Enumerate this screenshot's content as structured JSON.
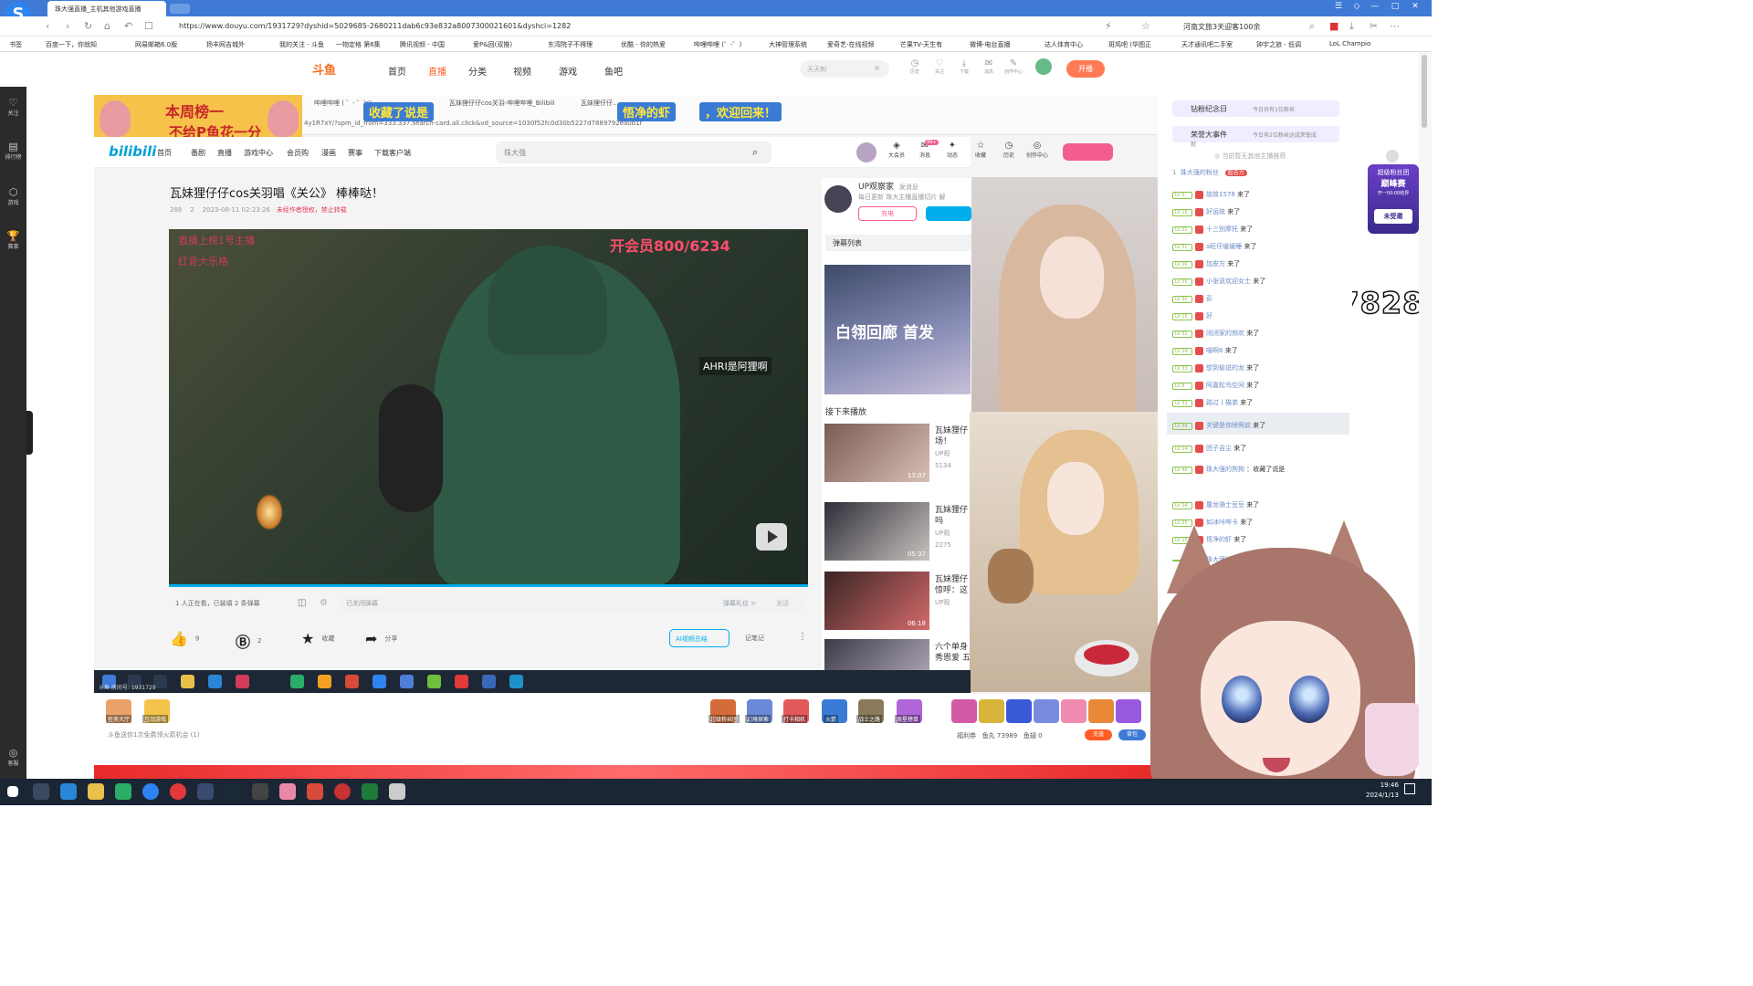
{
  "browser": {
    "tab_title": "珠大强直播_主机其他游戏直播",
    "url": "https://www.douyu.com/1931729?dyshid=5029685-2680211dab6c93e832a8007300021601&dyshci=1282",
    "right_text": "河南文旅3天迎客100余",
    "logo_letter": "S",
    "bookmarks": [
      "书签",
      "百度一下，你就知",
      "网易邮箱6.0版",
      "扬丰网吉城外",
      "我的关注 - 斗鱼",
      "一物定格 第6集",
      "腾讯视频 - 中国",
      "爱P&回(双推)",
      "东湾院子不得理",
      "优酷 - 你的热爱",
      "哔哩哔哩 (゜-゜)",
      "大神管理系统",
      "爱奇艺-在线视频",
      "芒果TV-天生有",
      "微博-电台直播",
      "达人体育中心",
      "斑鸠吧 (华图正",
      "天才通讯吧二手室",
      "钟宇之旅 - 低调",
      "LoL Champio"
    ]
  },
  "douyu": {
    "logo": "斗鱼",
    "nav": [
      "首页",
      "直播",
      "分类",
      "视频",
      "游戏",
      "鱼吧"
    ],
    "search_placeholder": "天天刺",
    "header_icons": [
      "历史",
      "关注",
      "下载",
      "消息",
      "创作中心"
    ],
    "badge_msg": "1",
    "badge_user": "83",
    "kaibo": "开播",
    "left_sidebar": [
      {
        "icon": "♡",
        "label": "关注"
      },
      {
        "icon": "▤",
        "label": "排行榜"
      },
      {
        "icon": "⬡",
        "label": "游戏"
      },
      {
        "icon": "🏆",
        "label": "赛事"
      },
      {
        "icon": "◎",
        "label": "客服"
      }
    ]
  },
  "stream": {
    "banner_line1": "本周榜一",
    "banner_line2": "不给P鱼花一分",
    "banner_tags": [
      "收藏了说是",
      "悟净的虾",
      "，欢迎回来！"
    ],
    "inner_tabs": [
      "哔哩哔哩 ( ゜- ゜)つ",
      "瓦妹狸仔仔cos关羽-哔哩哔哩_Bilibili",
      "瓦妹狸仔仔..."
    ],
    "inner_url": "4y1R7xY/?spm_id_from=333.337.search-card.all.click&vd_source=1030f52fc0d30b5227d7889792ea0b1f",
    "bilibili": {
      "logo": "bilibili",
      "nav": [
        "首页",
        "番剧",
        "直播",
        "游戏中心",
        "会员购",
        "漫画",
        "赛事",
        "下载客户端"
      ],
      "search_placeholder": "珠大强",
      "icons": [
        "大会员",
        "消息",
        "动态",
        "收藏",
        "历史",
        "创作中心"
      ],
      "message_badge": "99+",
      "video_title": "瓦妹狸仔仔cos关羽唱《关公》 棒棒哒！",
      "meta_views": "288",
      "meta_danmu": "2",
      "meta_date": "2023-08-11 02:23:26",
      "meta_warning": "未经作者授权，禁止转载",
      "overlay_wm1": "直播上榜1号主播",
      "overlay_wm2": "红音大乐格",
      "overlay_counter": "开会员800/6234",
      "overlay_tag": "AHRI是阿狸啊",
      "watching": "1 人正在看，已装填 2 条弹幕",
      "danmu_placeholder": "已关闭弹幕",
      "danmu_gift": "弹幕礼仪 >",
      "send": "发送",
      "like_count": "9",
      "coin_count": "2",
      "collect": "收藏",
      "share": "分享",
      "ai_summary": "AI视频总结",
      "notes": "记笔记",
      "up_label": "UP观察家",
      "up_msg": "发消息",
      "up_sub": "每日更新 珠大主播直播切片 解",
      "charge": "充电",
      "danmu_list": "弹幕列表",
      "promo_text": "白翎回廊 首发",
      "next_play": "接下来播放",
      "recommend": [
        {
          "title": "瓦妹狸仔",
          "line2": "场！",
          "up": "UP观",
          "views": "5134",
          "duration": "13:07"
        },
        {
          "title": "瓦妹狸仔",
          "line2": "吗",
          "up": "UP观",
          "views": "2275",
          "duration": "05:37"
        },
        {
          "title": "瓦妹狸仔",
          "line2": "惊呼：这",
          "up": "UP观",
          "views": "",
          "duration": "06:18"
        },
        {
          "title": "六个单身",
          "line2": "秀恩爱 五",
          "up": "",
          "views": "",
          "duration": ""
        }
      ]
    },
    "qq_number": "485477828",
    "room_info": "斗鱼 房间号: 1931729",
    "msg_line": "斗鱼送你1次免费领火箭机会 (1)",
    "gifts": [
      "任务大厅",
      "互动游戏",
      "超级粉丝团",
      "幻境探索",
      "打卡相机",
      "火箭",
      "战士之路",
      "周星榜单"
    ],
    "fish_wan": "鱼丸 73989",
    "fish_chi": "鱼翅 0",
    "recharge": "充值",
    "backpack": "背包",
    "fans_count": "福利券"
  },
  "chat": {
    "top_items": [
      {
        "title": "钻粉纪念日",
        "sub": "今日共有1位粉丝"
      },
      {
        "title": "荣誉大事件",
        "sub": "今日有2位粉丝达成荣誉成就"
      }
    ],
    "notice": "◎ 当前暂无其他主播推荐",
    "rank_title": "珠大强的粉丝",
    "rank_badge": "超吉力",
    "messages": [
      {
        "lv": "LV 5",
        "name": "故故1578",
        "text": "来了"
      },
      {
        "lv": "LV 16",
        "name": "好运故",
        "text": "来了"
      },
      {
        "lv": "LV 21",
        "name": "十三别摩托",
        "text": "来了"
      },
      {
        "lv": "LV 31",
        "name": "a旺仔缓缓睡",
        "text": "来了"
      },
      {
        "lv": "LV 26",
        "name": "加皮方",
        "text": "来了"
      },
      {
        "lv": "LV 35",
        "name": "小张说欢迎女士",
        "text": "来了"
      },
      {
        "lv": "LV 30",
        "name": "彭",
        "text": ""
      },
      {
        "lv": "LV 15",
        "name": "好",
        "text": ""
      },
      {
        "lv": "LV 32",
        "name": "闭闭家的频欢",
        "text": "来了"
      },
      {
        "lv": "LV 24",
        "name": "喵啊6",
        "text": "来了"
      },
      {
        "lv": "LV 33",
        "name": "想到偷说的龙",
        "text": "来了"
      },
      {
        "lv": "LV 8",
        "name": "阿嘉松鸟空间",
        "text": "来了"
      },
      {
        "lv": "LV 33",
        "name": "路过丨猫弟",
        "text": "来了"
      },
      {
        "lv": "LV 44",
        "name": "关键是你除照前",
        "text": "来了"
      },
      {
        "lv": "LV 14",
        "name": "团子吉尘",
        "text": "来了"
      },
      {
        "lv": "LV 40",
        "name": "珠大强的狗狗",
        "text": "：收藏了说是"
      },
      {
        "lv": "LV 24",
        "name": "屠龙骑士豆豆",
        "text": "来了"
      },
      {
        "lv": "LV 25",
        "name": "如冰咔哔卡",
        "text": "来了"
      },
      {
        "lv": "LV 13",
        "name": "悟净的虾",
        "text": "来了"
      },
      {
        "lv": "",
        "name": "珠大强的狗狗",
        "text": "："
      }
    ],
    "fan_badge_title": "超级粉丝团",
    "fan_badge_line": "巅峰赛",
    "fan_badge_time": "开一00:00结界",
    "fan_badge_btn": "未受邀"
  },
  "taskbar": {
    "time": "19:46",
    "date": "2024/1/13"
  }
}
